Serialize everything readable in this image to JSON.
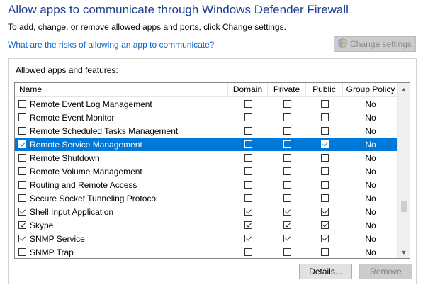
{
  "header": {
    "title": "Allow apps to communicate through Windows Defender Firewall",
    "subtitle": "To add, change, or remove allowed apps and ports, click Change settings.",
    "risk_link": "What are the risks of allowing an app to communicate?",
    "change_settings_label": "Change settings"
  },
  "group": {
    "label": "Allowed apps and features:",
    "columns": {
      "name": "Name",
      "domain": "Domain",
      "private": "Private",
      "public": "Public",
      "group_policy": "Group Policy"
    },
    "rows": [
      {
        "name": "Remote Event Log Management",
        "enabled": false,
        "domain": false,
        "private": false,
        "public": false,
        "group_policy": "No"
      },
      {
        "name": "Remote Event Monitor",
        "enabled": false,
        "domain": false,
        "private": false,
        "public": false,
        "group_policy": "No"
      },
      {
        "name": "Remote Scheduled Tasks Management",
        "enabled": false,
        "domain": false,
        "private": false,
        "public": false,
        "group_policy": "No"
      },
      {
        "name": "Remote Service Management",
        "enabled": true,
        "domain": false,
        "private": false,
        "public": true,
        "group_policy": "No",
        "selected": true
      },
      {
        "name": "Remote Shutdown",
        "enabled": false,
        "domain": false,
        "private": false,
        "public": false,
        "group_policy": "No"
      },
      {
        "name": "Remote Volume Management",
        "enabled": false,
        "domain": false,
        "private": false,
        "public": false,
        "group_policy": "No"
      },
      {
        "name": "Routing and Remote Access",
        "enabled": false,
        "domain": false,
        "private": false,
        "public": false,
        "group_policy": "No"
      },
      {
        "name": "Secure Socket Tunneling Protocol",
        "enabled": false,
        "domain": false,
        "private": false,
        "public": false,
        "group_policy": "No"
      },
      {
        "name": "Shell Input Application",
        "enabled": true,
        "domain": true,
        "private": true,
        "public": true,
        "group_policy": "No"
      },
      {
        "name": "Skype",
        "enabled": true,
        "domain": true,
        "private": true,
        "public": true,
        "group_policy": "No"
      },
      {
        "name": "SNMP Service",
        "enabled": true,
        "domain": true,
        "private": true,
        "public": true,
        "group_policy": "No"
      },
      {
        "name": "SNMP Trap",
        "enabled": false,
        "domain": false,
        "private": false,
        "public": false,
        "group_policy": "No"
      }
    ]
  },
  "buttons": {
    "details": "Details...",
    "remove": "Remove"
  },
  "icons": {
    "shield": "uac-shield-icon",
    "scroll_up": "chevron-up-icon",
    "scroll_down": "chevron-down-icon"
  },
  "colors": {
    "title": "#1e3f8f",
    "link": "#0a64c8",
    "selection": "#0078d7"
  }
}
